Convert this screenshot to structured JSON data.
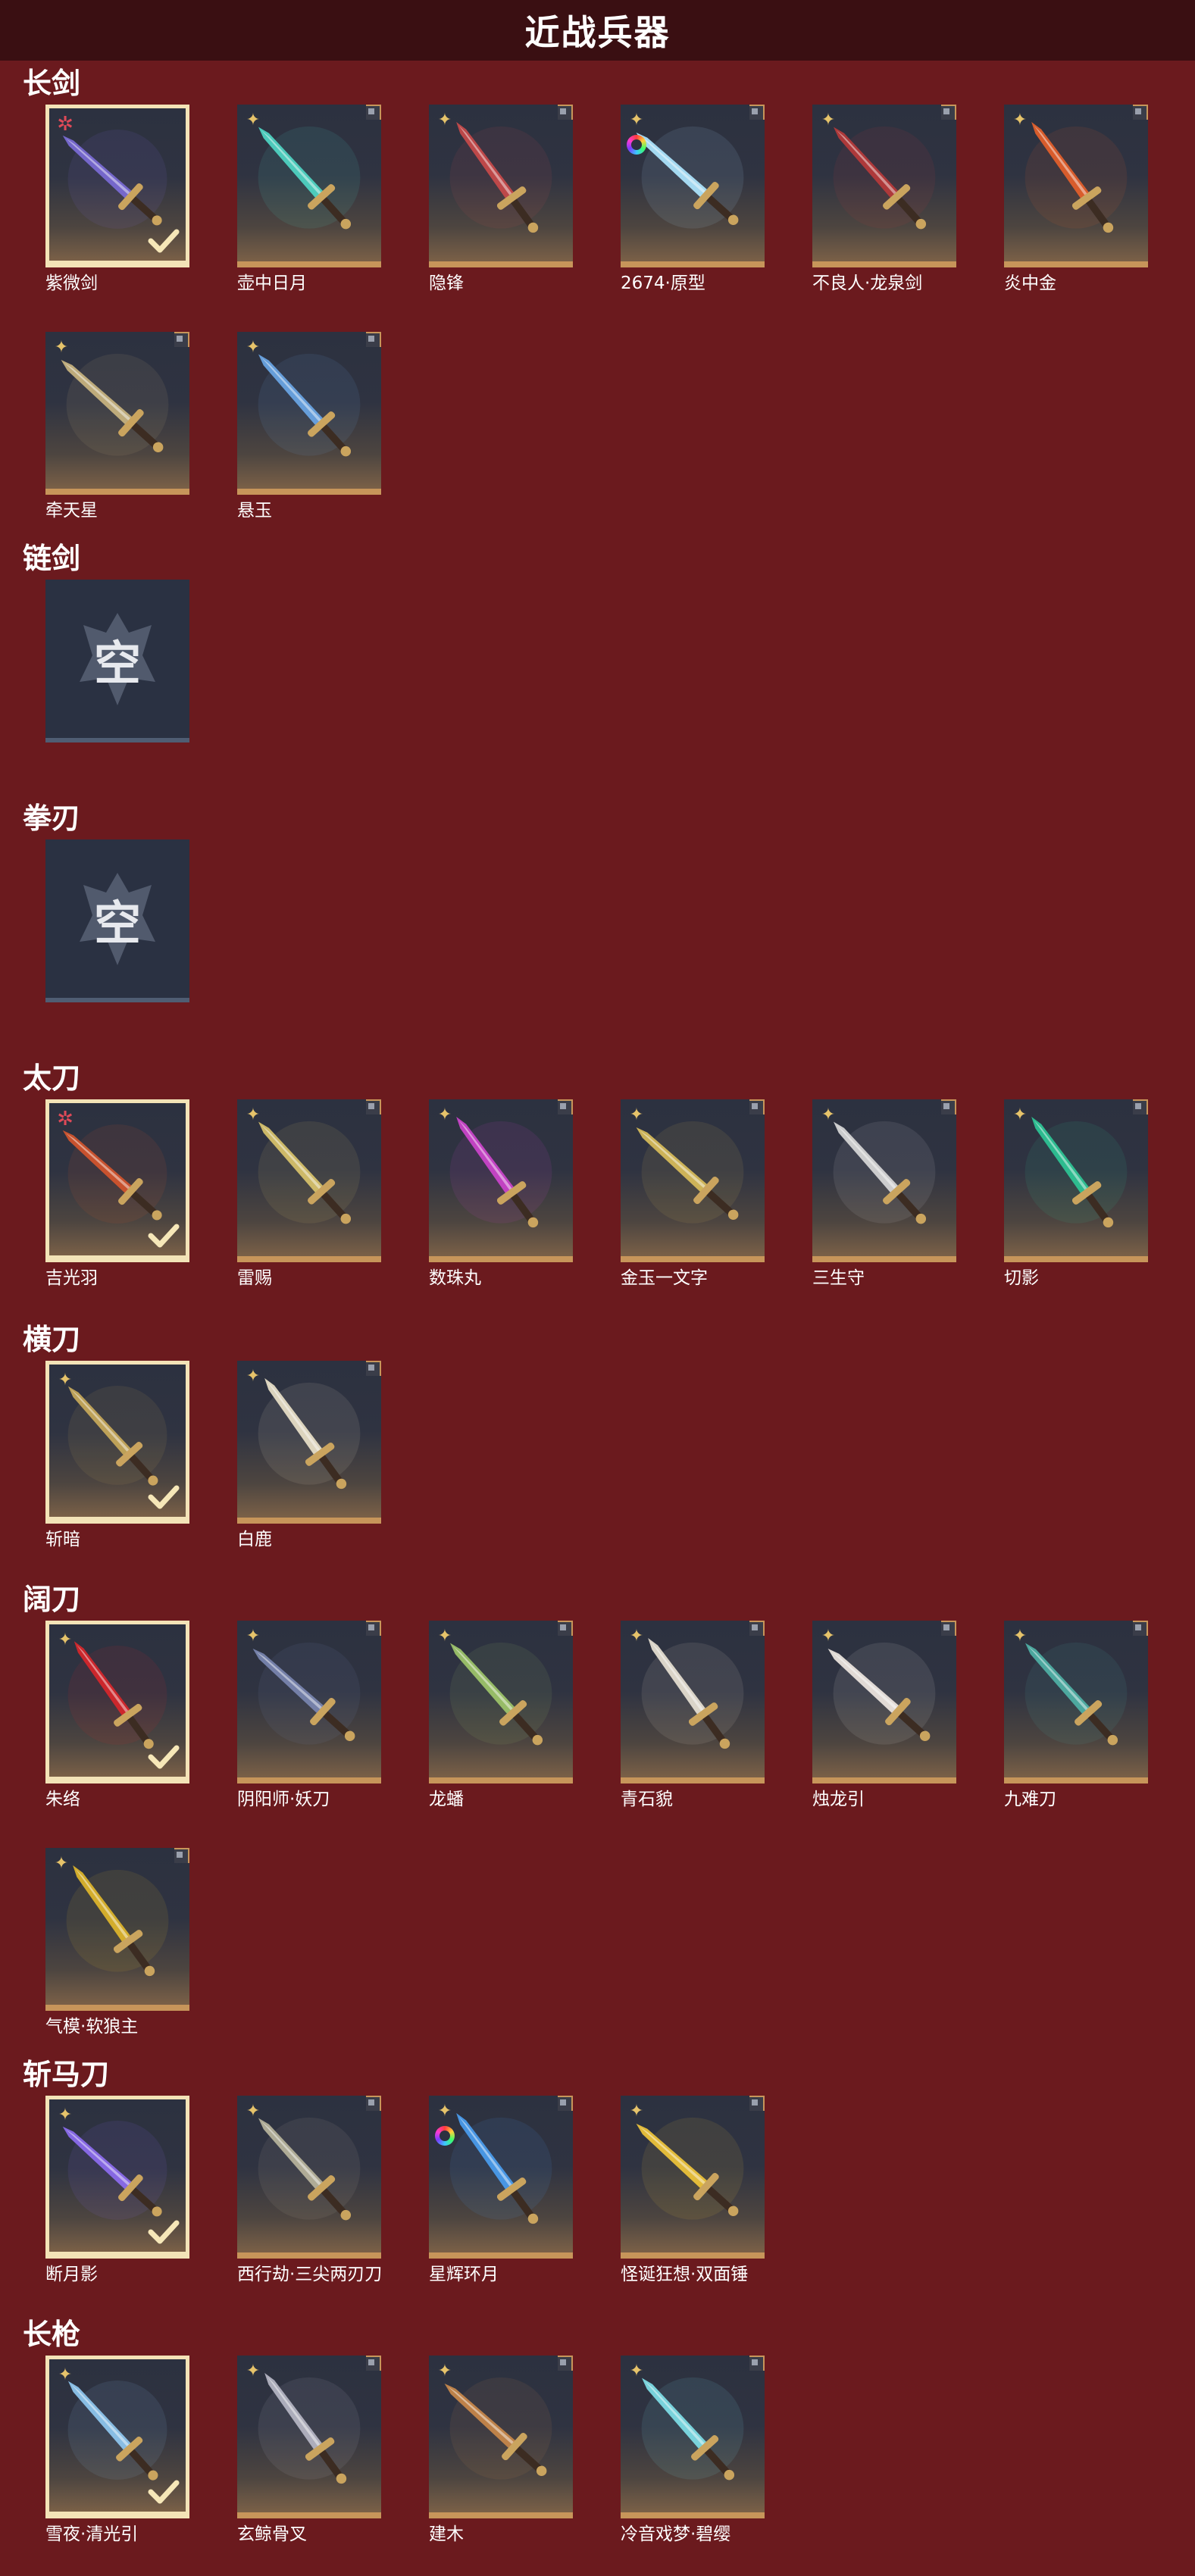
{
  "header": {
    "title": "近战兵器"
  },
  "empty_text": "空",
  "sections": [
    {
      "title": "长剑",
      "items": [
        {
          "name": "紫微剑",
          "selected": true,
          "badge": "red",
          "check": true,
          "color": "#7b6bd6"
        },
        {
          "name": "壶中日月",
          "badge": "gold",
          "color": "#4fd6c4"
        },
        {
          "name": "隐锋",
          "badge": "gold",
          "color": "#c84a4a"
        },
        {
          "name": "2674·原型",
          "badge": "gold",
          "ring": true,
          "color": "#aee6ff"
        },
        {
          "name": "不良人·龙泉剑",
          "badge": "gold",
          "color": "#b73a3a"
        },
        {
          "name": "炎中金",
          "badge": "gold",
          "color": "#e5602a"
        },
        {
          "name": "牵天星",
          "badge": "gold",
          "color": "#c9b480"
        },
        {
          "name": "悬玉",
          "badge": "gold",
          "color": "#6aa6e6"
        }
      ]
    },
    {
      "title": "链剑",
      "items": [
        {
          "empty": true
        }
      ]
    },
    {
      "title": "拳刃",
      "items": [
        {
          "empty": true
        }
      ]
    },
    {
      "title": "太刀",
      "items": [
        {
          "name": "吉光羽",
          "selected": true,
          "badge": "red",
          "check": true,
          "color": "#d4552c"
        },
        {
          "name": "雷赐",
          "badge": "gold",
          "color": "#d9c36b"
        },
        {
          "name": "数珠丸",
          "badge": "gold",
          "color": "#cc44cc"
        },
        {
          "name": "金玉一文字",
          "badge": "gold",
          "color": "#d9bd5a"
        },
        {
          "name": "三生守",
          "badge": "gold",
          "color": "#d8d8d8"
        },
        {
          "name": "切影",
          "badge": "gold",
          "color": "#2ec596"
        }
      ]
    },
    {
      "title": "横刀",
      "items": [
        {
          "name": "斩暗",
          "selected": true,
          "badge": "gold",
          "check": true,
          "color": "#c8a95a"
        },
        {
          "name": "白鹿",
          "badge": "gold",
          "color": "#e9e1c8"
        }
      ]
    },
    {
      "title": "阔刀",
      "items": [
        {
          "name": "朱络",
          "selected": true,
          "badge": "gold",
          "check": true,
          "color": "#d8262a"
        },
        {
          "name": "阴阳师·妖刀",
          "badge": "gold",
          "color": "#7a86b0"
        },
        {
          "name": "龙蟠",
          "badge": "gold",
          "color": "#9ec56a"
        },
        {
          "name": "青石貌",
          "badge": "gold",
          "color": "#e7e1d2"
        },
        {
          "name": "烛龙引",
          "badge": "gold",
          "color": "#efe7e1"
        },
        {
          "name": "九难刀",
          "badge": "gold",
          "color": "#4fb1a6"
        },
        {
          "name": "气模·软狼主",
          "badge": "gold",
          "color": "#e0b62a"
        }
      ]
    },
    {
      "title": "斩马刀",
      "items": [
        {
          "name": "断月影",
          "selected": true,
          "badge": "gold",
          "check": true,
          "color": "#8d6cf0"
        },
        {
          "name": "西行劫·三尖两刃刀",
          "badge": "gold",
          "color": "#b9b49c"
        },
        {
          "name": "星辉环月",
          "badge": "gold",
          "ring": true,
          "color": "#4a9df0"
        },
        {
          "name": "怪诞狂想·双面锤",
          "badge": "gold",
          "color": "#f0c53a"
        }
      ]
    },
    {
      "title": "长枪",
      "items": [
        {
          "name": "雪夜·清光引",
          "selected": true,
          "badge": "gold",
          "check": true,
          "color": "#8fc8f0"
        },
        {
          "name": "玄鲸骨叉",
          "badge": "gold",
          "color": "#b6b6c4"
        },
        {
          "name": "建木",
          "badge": "gold",
          "color": "#c9884a"
        },
        {
          "name": "冷音戏梦·碧缨",
          "badge": "gold",
          "color": "#7fe0e8"
        }
      ]
    }
  ]
}
